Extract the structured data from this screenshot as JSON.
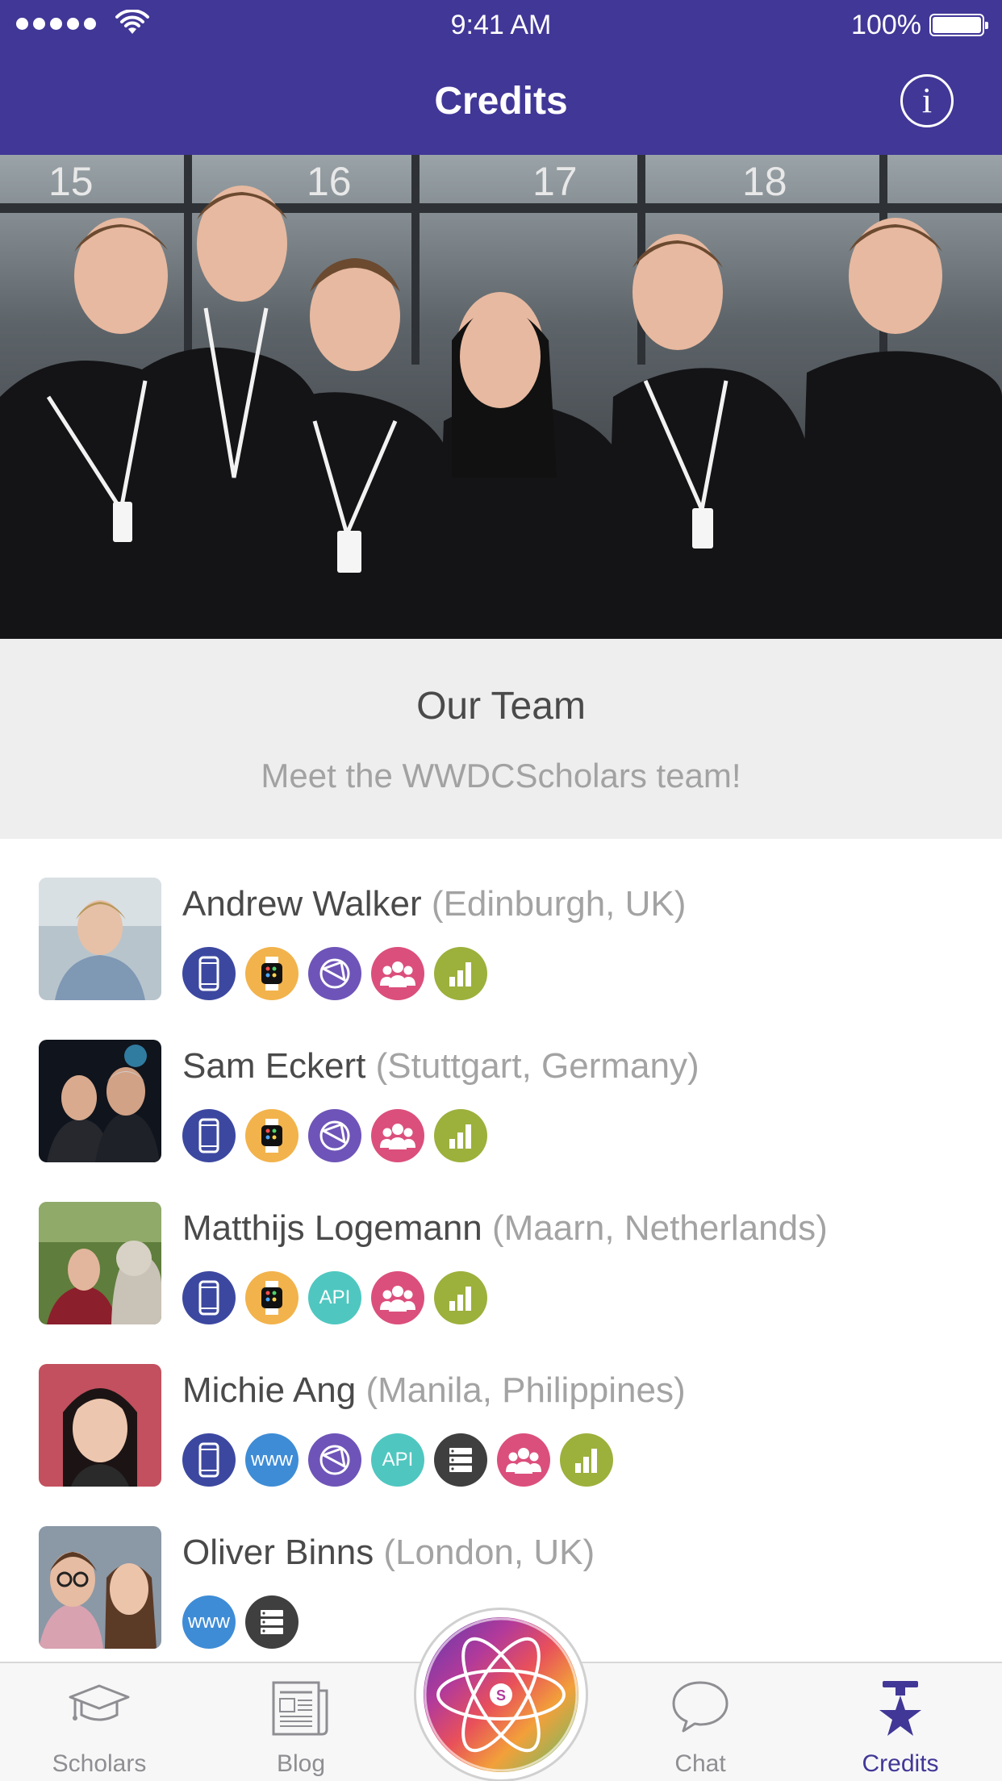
{
  "status_bar": {
    "time": "9:41 AM",
    "battery": "100%"
  },
  "nav": {
    "title": "Credits",
    "info_label": "i"
  },
  "hero": {
    "description": "Team group photo"
  },
  "team": {
    "title": "Our Team",
    "subtitle": "Meet the WWDCScholars team!"
  },
  "members": [
    {
      "name": "Andrew Walker",
      "location": "(Edinburgh, UK)",
      "badges": [
        "iphone-icon",
        "watch-icon",
        "design-icon",
        "team-icon",
        "analytics-icon"
      ]
    },
    {
      "name": "Sam Eckert",
      "location": "(Stuttgart, Germany)",
      "badges": [
        "iphone-icon",
        "watch-icon",
        "design-icon",
        "team-icon",
        "analytics-icon"
      ]
    },
    {
      "name": "Matthijs Logemann",
      "location": "(Maarn, Netherlands)",
      "badges": [
        "iphone-icon",
        "watch-icon",
        "api-icon",
        "team-icon",
        "analytics-icon"
      ]
    },
    {
      "name": "Michie Ang",
      "location": "(Manila, Philippines)",
      "badges": [
        "iphone-icon",
        "www-icon",
        "design-icon",
        "api-icon",
        "server-icon",
        "team-icon",
        "analytics-icon"
      ]
    },
    {
      "name": "Oliver Binns",
      "location": "(London, UK)",
      "badges": [
        "www-icon",
        "server-icon"
      ]
    }
  ],
  "badge_labels": {
    "api": "API",
    "www": "www"
  },
  "badge_colors": {
    "iphone": "#3c48a0",
    "watch": "#f2b34c",
    "design": "#6e54b8",
    "team": "#db4f7c",
    "analytics": "#9cb03c",
    "api": "#4fc7c0",
    "www": "#3e8cd6",
    "server": "#3f3f3f"
  },
  "tabs": [
    {
      "label": "Scholars",
      "icon": "graduation-cap-icon",
      "active": false
    },
    {
      "label": "Blog",
      "icon": "newspaper-icon",
      "active": false
    },
    {
      "label": "",
      "icon": "atom-logo-icon",
      "active": false
    },
    {
      "label": "Chat",
      "icon": "chat-bubble-icon",
      "active": false
    },
    {
      "label": "Credits",
      "icon": "star-icon",
      "active": true
    }
  ],
  "colors": {
    "primary": "#413797",
    "tab_inactive": "#8e8e93"
  }
}
